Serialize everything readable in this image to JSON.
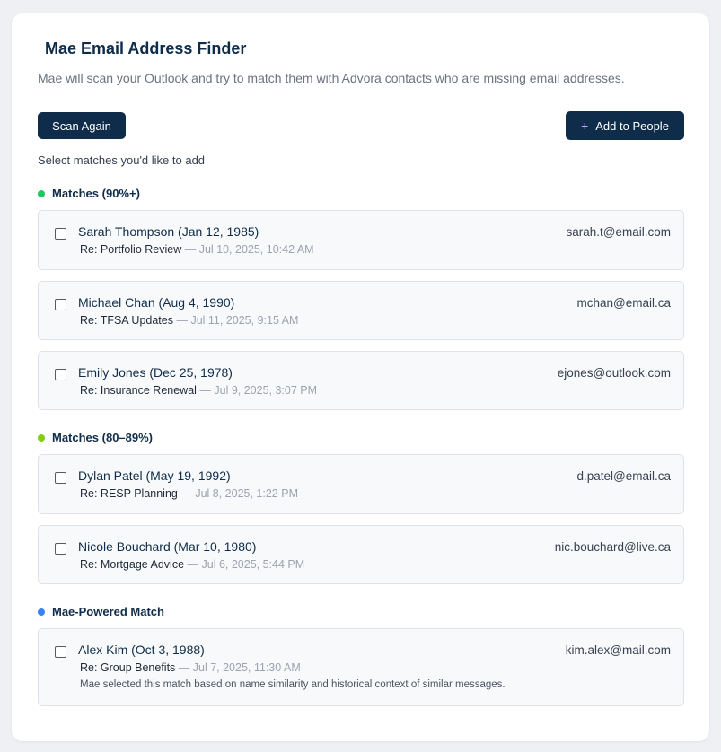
{
  "header": {
    "title": "Mae Email Address Finder",
    "subtitle": "Mae will scan your Outlook and try to match them with Advora contacts who are missing email addresses."
  },
  "toolbar": {
    "scan_label": "Scan Again",
    "add_label": "Add to People",
    "add_icon": "+"
  },
  "hint": "Select matches you'd like to add",
  "colors": {
    "high": "#22c55e",
    "medium": "#84cc16",
    "mae": "#3b82f6"
  },
  "sections": [
    {
      "title": "Matches (90%+)",
      "items": [
        {
          "name": "Sarah Thompson (Jan 12, 1985)",
          "subject": "Re: Portfolio Review",
          "date": " — Jul 10, 2025, 10:42 AM",
          "email": "sarah.t@email.com"
        },
        {
          "name": "Michael Chan (Aug 4, 1990)",
          "subject": "Re: TFSA Updates",
          "date": " — Jul 11, 2025, 9:15 AM",
          "email": "mchan@email.ca"
        },
        {
          "name": "Emily Jones (Dec 25, 1978)",
          "subject": "Re: Insurance Renewal",
          "date": " — Jul 9, 2025, 3:07 PM",
          "email": "ejones@outlook.com"
        }
      ]
    },
    {
      "title": "Matches (80–89%)",
      "items": [
        {
          "name": "Dylan Patel (May 19, 1992)",
          "subject": "Re: RESP Planning",
          "date": " — Jul 8, 2025, 1:22 PM",
          "email": "d.patel@email.ca"
        },
        {
          "name": "Nicole Bouchard (Mar 10, 1980)",
          "subject": "Re: Mortgage Advice",
          "date": " — Jul 6, 2025, 5:44 PM",
          "email": "nic.bouchard@live.ca"
        }
      ]
    },
    {
      "title": "Mae-Powered Match",
      "items": [
        {
          "name": "Alex Kim (Oct 3, 1988)",
          "subject": "Re: Group Benefits",
          "date": " — Jul 7, 2025, 11:30 AM",
          "email": "kim.alex@mail.com",
          "note": "Mae selected this match based on name similarity and historical context of similar messages."
        }
      ]
    }
  ]
}
